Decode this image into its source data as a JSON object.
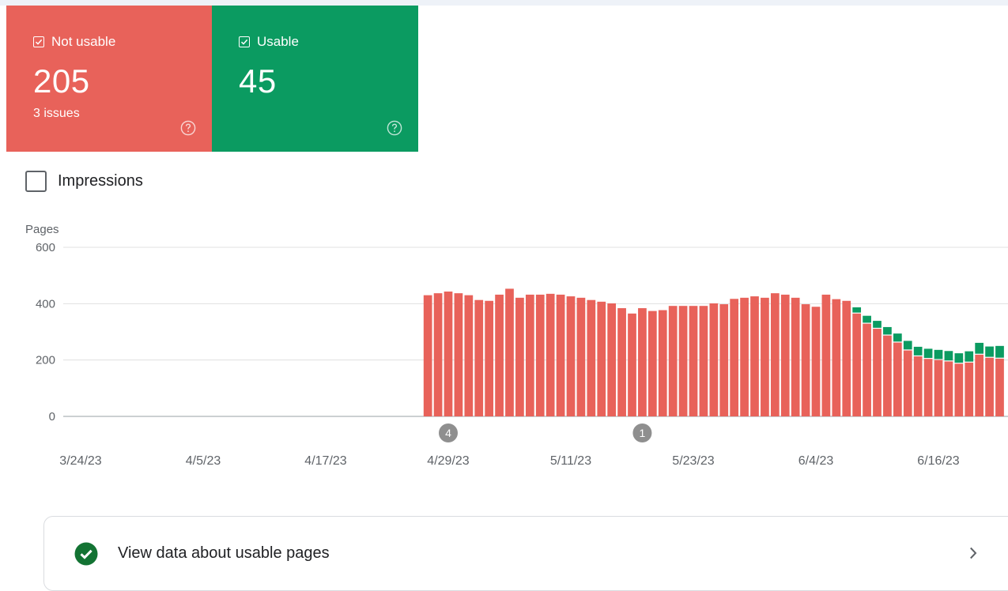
{
  "summary": {
    "not_usable": {
      "label": "Not usable",
      "count": "205",
      "issues": "3 issues"
    },
    "usable": {
      "label": "Usable",
      "count": "45"
    }
  },
  "impressions_label": "Impressions",
  "footer": {
    "label": "View data about usable pages"
  },
  "colors": {
    "not_usable": "#e8625a",
    "usable": "#0b9b61"
  },
  "chart_data": {
    "type": "bar",
    "stacked": true,
    "ylabel": "Pages",
    "ylim": [
      0,
      600
    ],
    "yticks": [
      0,
      200,
      400,
      600
    ],
    "x_tick_labels": [
      "3/24/23",
      "4/5/23",
      "4/17/23",
      "4/29/23",
      "5/11/23",
      "5/23/23",
      "6/4/23",
      "6/16/23"
    ],
    "annotations": [
      {
        "label": "4",
        "x": "4/29/23"
      },
      {
        "label": "1",
        "x": "5/18/23"
      }
    ],
    "x_start": "3/24/23",
    "x_end": "6/23/23",
    "data_start": "4/27/23",
    "series": [
      {
        "name": "Not usable",
        "color": "#e8625a",
        "values": [
          430,
          437,
          443,
          437,
          430,
          413,
          410,
          432,
          453,
          421,
          432,
          432,
          435,
          432,
          426,
          421,
          413,
          407,
          401,
          384,
          365,
          384,
          374,
          377,
          392,
          392,
          392,
          392,
          401,
          398,
          417,
          421,
          426,
          421,
          437,
          432,
          421,
          398,
          389,
          432,
          416,
          410,
          365,
          329,
          311,
          287,
          262,
          234,
          213,
          204,
          200,
          195,
          187,
          191,
          219,
          208,
          205
        ]
      },
      {
        "name": "Usable",
        "color": "#0b9b61",
        "values": [
          0,
          0,
          0,
          0,
          0,
          0,
          0,
          0,
          0,
          0,
          0,
          0,
          0,
          0,
          0,
          0,
          0,
          0,
          0,
          0,
          0,
          0,
          0,
          0,
          0,
          0,
          0,
          0,
          0,
          0,
          0,
          0,
          0,
          0,
          0,
          0,
          0,
          0,
          0,
          0,
          0,
          0,
          22,
          28,
          28,
          30,
          32,
          34,
          34,
          36,
          36,
          37,
          37,
          40,
          42,
          40,
          45
        ]
      }
    ]
  }
}
